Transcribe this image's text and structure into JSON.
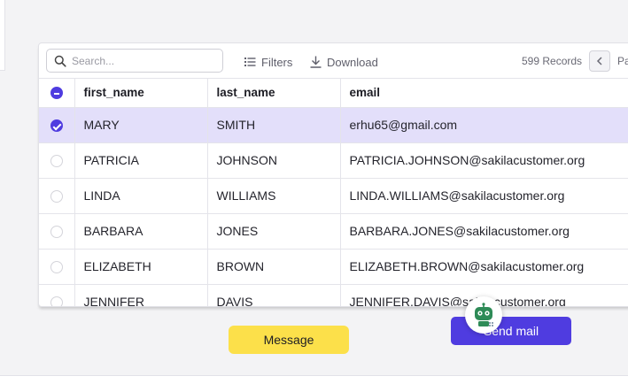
{
  "toolbar": {
    "search_placeholder": "Search...",
    "filters_label": "Filters",
    "download_label": "Download",
    "records_label": "599 Records",
    "page_label": "Pa"
  },
  "table": {
    "columns": [
      "first_name",
      "last_name",
      "email"
    ],
    "rows": [
      {
        "first_name": "MARY",
        "last_name": "SMITH",
        "email": "erhu65@gmail.com",
        "selected": true
      },
      {
        "first_name": "PATRICIA",
        "last_name": "JOHNSON",
        "email": "PATRICIA.JOHNSON@sakilacustomer.org",
        "selected": false
      },
      {
        "first_name": "LINDA",
        "last_name": "WILLIAMS",
        "email": "LINDA.WILLIAMS@sakilacustomer.org",
        "selected": false
      },
      {
        "first_name": "BARBARA",
        "last_name": "JONES",
        "email": "BARBARA.JONES@sakilacustomer.org",
        "selected": false
      },
      {
        "first_name": "ELIZABETH",
        "last_name": "BROWN",
        "email": "ELIZABETH.BROWN@sakilacustomer.org",
        "selected": false
      },
      {
        "first_name": "JENNIFER",
        "last_name": "DAVIS",
        "email": "JENNIFER.DAVIS@sakilacustomer.org",
        "selected": false
      }
    ]
  },
  "actions": {
    "message_label": "Message",
    "send_mail_label": "Send mail"
  },
  "icons": {
    "search": "search-icon",
    "filters": "filter-lines-icon",
    "download": "download-icon",
    "prev": "chevron-left-icon",
    "bot": "robot-icon"
  },
  "colors": {
    "accent": "#4f3ce0",
    "selected_row": "#e3dffa",
    "message_button": "#fce04a",
    "bot_green": "#2e8b57"
  }
}
